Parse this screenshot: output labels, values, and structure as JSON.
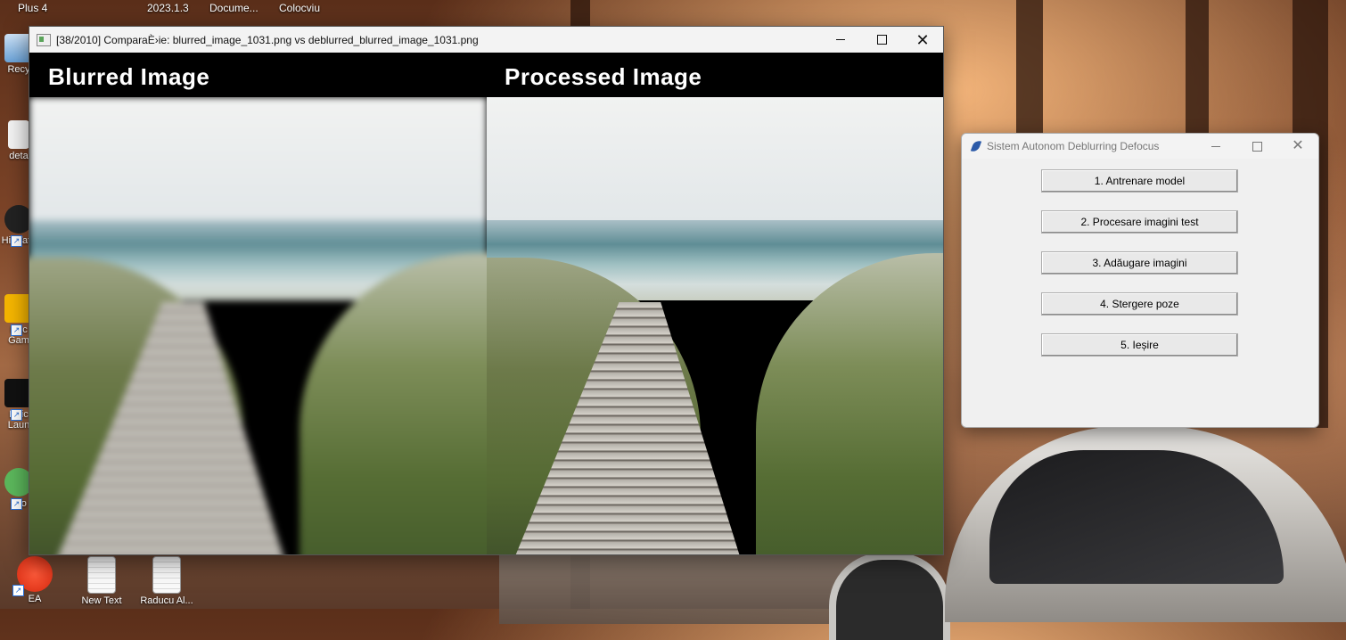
{
  "desktop": {
    "topbar": [
      "Plus 4",
      "2023.1.3",
      "Docume...",
      "Colocviu"
    ],
    "icons": [
      {
        "label": "Recy"
      },
      {
        "label": "deta"
      },
      {
        "label": "Hi Wate"
      },
      {
        "label": "Roc Gam"
      },
      {
        "label": "Epic Laun"
      },
      {
        "label": "pTo"
      },
      {
        "label": "EA"
      },
      {
        "label": "New Text"
      },
      {
        "label": "Raducu Al..."
      }
    ]
  },
  "compare_window": {
    "title": "[38/2010] ComparaÈ›ie: blurred_image_1031.png vs deblurred_blurred_image_1031.png",
    "left_title": "Blurred Image",
    "right_title": "Processed Image"
  },
  "app_window": {
    "title": "Sistem Autonom Deblurring Defocus",
    "buttons": [
      "1. Antrenare model",
      "2. Procesare imagini test",
      "3. Adăugare imagini",
      "4. Stergere poze",
      "5. Ieșire"
    ]
  }
}
